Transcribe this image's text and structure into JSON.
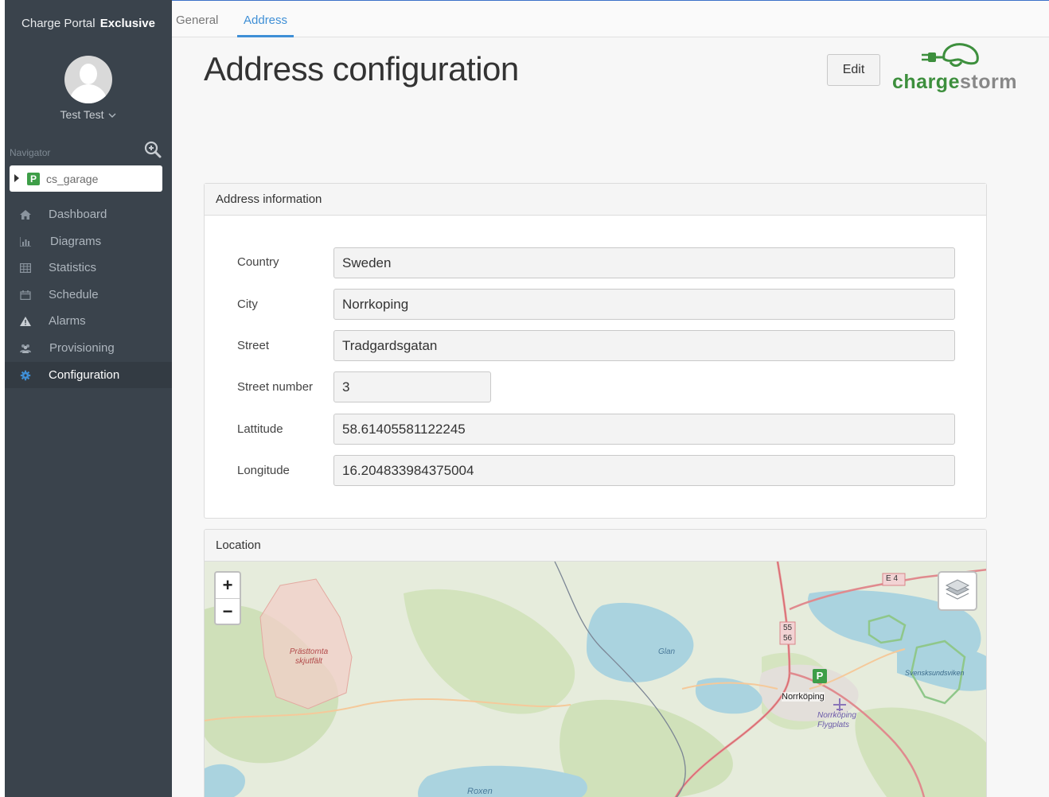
{
  "app": {
    "brand_prefix": "Charge Portal",
    "brand_strong": "Exclusive",
    "user_name": "Test Test",
    "navigator_label": "Navigator",
    "site_name": "cs_garage",
    "site_badge": "P"
  },
  "sidebar": {
    "items": [
      {
        "label": "Dashboard",
        "icon": "home-icon"
      },
      {
        "label": "Diagrams",
        "icon": "bar-chart-icon"
      },
      {
        "label": "Statistics",
        "icon": "table-icon"
      },
      {
        "label": "Schedule",
        "icon": "calendar-icon"
      },
      {
        "label": "Alarms",
        "icon": "warning-icon"
      },
      {
        "label": "Provisioning",
        "icon": "users-icon"
      },
      {
        "label": "Configuration",
        "icon": "gear-icon",
        "active": true
      }
    ]
  },
  "tabs": [
    {
      "label": "General"
    },
    {
      "label": "Address",
      "active": true
    }
  ],
  "page": {
    "title": "Address configuration",
    "edit_label": "Edit",
    "logo_part1": "charge",
    "logo_part2": "storm"
  },
  "address_panel": {
    "title": "Address information",
    "fields": {
      "country": {
        "label": "Country",
        "value": "Sweden"
      },
      "city": {
        "label": "City",
        "value": "Norrkoping"
      },
      "street": {
        "label": "Street",
        "value": "Tradgardsgatan"
      },
      "street_number": {
        "label": "Street number",
        "value": "3"
      },
      "latitude": {
        "label": "Lattitude",
        "value": "58.61405581122245"
      },
      "longitude": {
        "label": "Longitude",
        "value": "16.204833984375004"
      }
    }
  },
  "location_panel": {
    "title": "Location",
    "zoom_in": "+",
    "zoom_out": "−",
    "map_labels": {
      "range": "Prästtomta skjutfält",
      "lake_glan": "Glan",
      "city": "Norrköping",
      "airport": "Norrköping Flygplats",
      "bay": "Svensksundsviken",
      "lake_roxen": "Roxen",
      "road_e4": "E 4",
      "road_55": "55",
      "road_56": "56",
      "marker_badge": "P"
    }
  },
  "colors": {
    "sidebar_bg": "#3a434c",
    "accent_blue": "#3f8fd6",
    "brand_green": "#3d8f3d",
    "parking_green": "#3e9e48"
  }
}
